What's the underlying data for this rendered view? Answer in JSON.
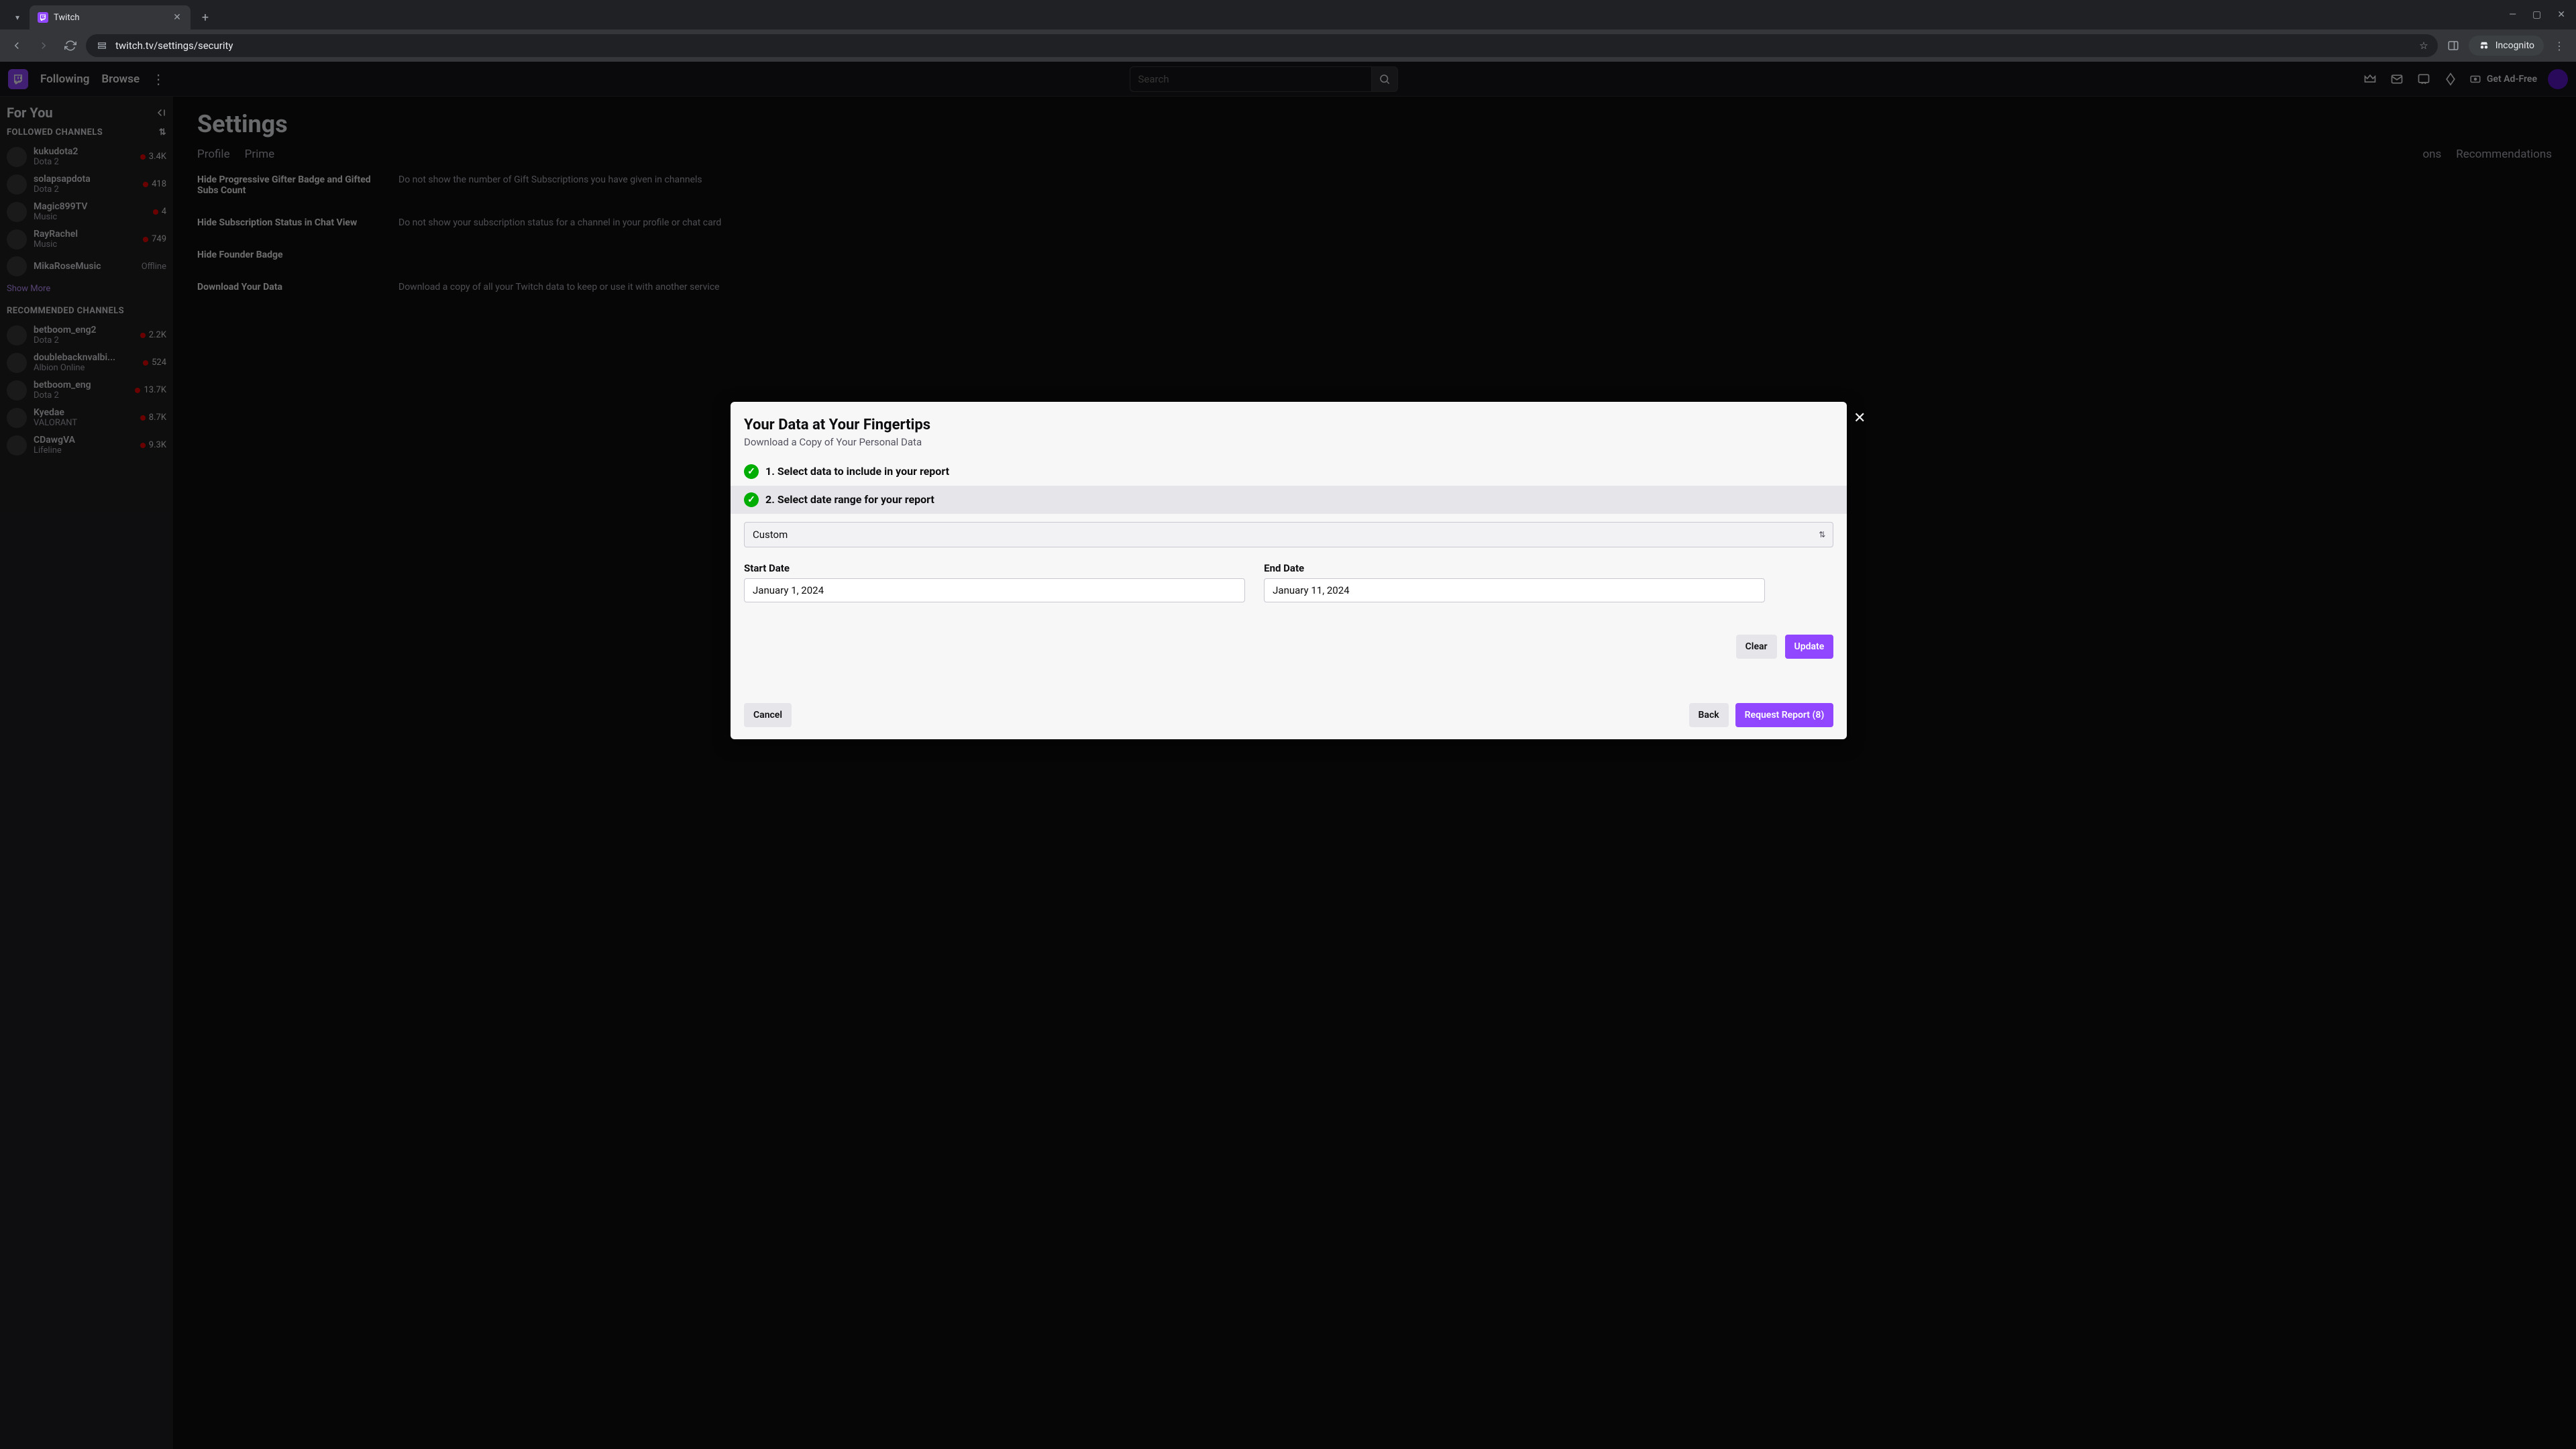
{
  "browser": {
    "tab_title": "Twitch",
    "url": "twitch.tv/settings/security",
    "incognito_label": "Incognito"
  },
  "topnav": {
    "following": "Following",
    "browse": "Browse",
    "search_placeholder": "Search",
    "adfree": "Get Ad-Free"
  },
  "sidebar": {
    "for_you": "For You",
    "followed_title": "FOLLOWED CHANNELS",
    "recommended_title": "RECOMMENDED CHANNELS",
    "show_more": "Show More",
    "followed": [
      {
        "name": "kukudota2",
        "game": "Dota 2",
        "viewers": "3.4K",
        "live": true
      },
      {
        "name": "solapsapdota",
        "game": "Dota 2",
        "viewers": "418",
        "live": true
      },
      {
        "name": "Magic899TV",
        "game": "Music",
        "viewers": "4",
        "live": true
      },
      {
        "name": "RayRachel",
        "game": "Music",
        "viewers": "749",
        "live": true
      },
      {
        "name": "MikaRoseMusic",
        "game": "",
        "viewers": "Offline",
        "live": false
      }
    ],
    "recommended": [
      {
        "name": "betboom_eng2",
        "game": "Dota 2",
        "viewers": "2.2K",
        "live": true
      },
      {
        "name": "doublebacknvalbi...",
        "game": "Albion Online",
        "viewers": "524",
        "live": true
      },
      {
        "name": "betboom_eng",
        "game": "Dota 2",
        "viewers": "13.7K",
        "live": true
      },
      {
        "name": "Kyedae",
        "game": "VALORANT",
        "viewers": "8.7K",
        "live": true
      },
      {
        "name": "CDawgVA",
        "game": "Lifeline",
        "viewers": "9.3K",
        "live": true
      }
    ]
  },
  "main": {
    "title": "Settings",
    "tabs": [
      "Profile",
      "Prime",
      "",
      "",
      "",
      "",
      "Recommendations"
    ],
    "tabs_partial_right": "ons",
    "rows": [
      {
        "label": "Hide Progressive Gifter Badge and Gifted Subs Count",
        "desc": "Do not show the number of Gift Subscriptions you have given in channels"
      },
      {
        "label": "Hide Subscription Status in Chat View",
        "desc": "Do not show your subscription status for a channel in your profile or chat card"
      },
      {
        "label": "Hide Founder Badge",
        "desc": ""
      },
      {
        "label": "Download Your Data",
        "desc": "Download a copy of all your Twitch data to keep or use it with another service"
      }
    ]
  },
  "modal": {
    "title": "Your Data at Your Fingertips",
    "subtitle": "Download a Copy of Your Personal Data",
    "step1": "1. Select data to include in your report",
    "step2": "2. Select date range for your report",
    "range_selected": "Custom",
    "start_label": "Start Date",
    "start_value": "January 1, 2024",
    "end_label": "End Date",
    "end_value": "January 11, 2024",
    "clear": "Clear",
    "update": "Update",
    "cancel": "Cancel",
    "back": "Back",
    "request": "Request Report (8)"
  }
}
